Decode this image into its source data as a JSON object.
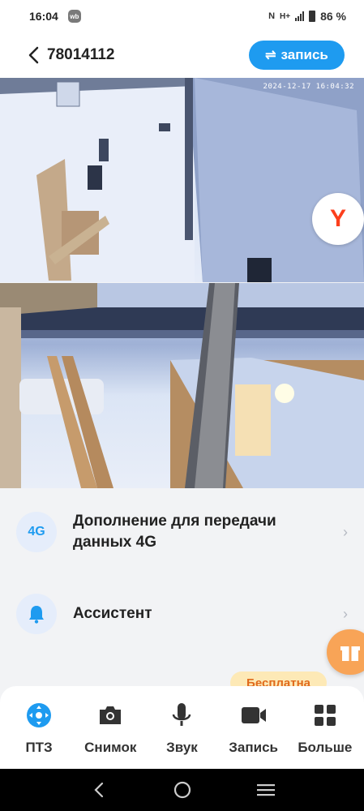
{
  "status_bar": {
    "time": "16:04",
    "app_badge": "wb",
    "nfc": "N",
    "network_type": "H+",
    "battery_percent": "86 %"
  },
  "header": {
    "title": "78014112",
    "record_button_label": "запись"
  },
  "camera": {
    "timestamp": "2024-12-17 16:04:32",
    "yandex_logo": "Y"
  },
  "list": {
    "items": [
      {
        "icon": "4G",
        "label": "Дополнение для передачи данных 4G"
      },
      {
        "icon": "bell-icon",
        "label": "Ассистент"
      }
    ],
    "partial_badge": "Бесплатна"
  },
  "toolbar": {
    "items": [
      {
        "icon": "ptz-icon",
        "label": "ПТЗ"
      },
      {
        "icon": "camera-icon",
        "label": "Снимок"
      },
      {
        "icon": "microphone-icon",
        "label": "Звук"
      },
      {
        "icon": "video-icon",
        "label": "Запись"
      },
      {
        "icon": "grid-icon",
        "label": "Больше"
      }
    ]
  },
  "colors": {
    "accent": "#1e9bf0",
    "icon_bg": "#e5edfb",
    "badge_bg": "#fde9b6",
    "badge_text": "#e06a1c",
    "gift": "#f8a457"
  }
}
